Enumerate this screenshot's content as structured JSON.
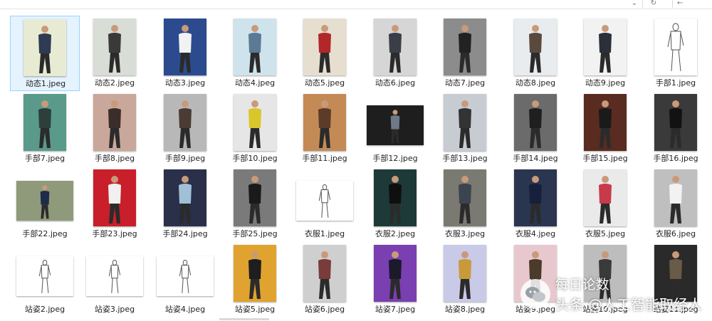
{
  "toolbar": {
    "chevron": "⌄",
    "refresh": "↻",
    "back": "←"
  },
  "colors": {
    "selection_bg": "#e5f3ff",
    "selection_border": "#99d1ff"
  },
  "files": [
    {
      "name": "动态1.jpeg",
      "bg": "#e8ebd3",
      "fig": "#2f3b52",
      "selected": true,
      "kind": "photo"
    },
    {
      "name": "动态2.jpeg",
      "bg": "#d8ddd6",
      "fig": "#3a3a3a",
      "kind": "photo"
    },
    {
      "name": "动态3.jpeg",
      "bg": "#2c4b8f",
      "fig": "#f2f2f2",
      "kind": "photo"
    },
    {
      "name": "动态4.jpeg",
      "bg": "#cfe3ec",
      "fig": "#5b7a95",
      "kind": "photo"
    },
    {
      "name": "动态5.jpeg",
      "bg": "#e6dfd0",
      "fig": "#b3262a",
      "kind": "photo"
    },
    {
      "name": "动态6.jpeg",
      "bg": "#d6d6d6",
      "fig": "#3a3f47",
      "kind": "photo"
    },
    {
      "name": "动态7.jpeg",
      "bg": "#8c8c8c",
      "fig": "#222222",
      "kind": "photo"
    },
    {
      "name": "动态8.jpeg",
      "bg": "#e9ecef",
      "fig": "#5a4a3e",
      "kind": "photo"
    },
    {
      "name": "动态9.jpeg",
      "bg": "#f2f2f2",
      "fig": "#2a2f3a",
      "kind": "photo"
    },
    {
      "name": "手部1.jpeg",
      "bg": "#ffffff",
      "fig": "#555555",
      "kind": "sketch"
    },
    {
      "name": "手部7.jpeg",
      "bg": "#5a9a8a",
      "fig": "#2d3f3b",
      "kind": "photo"
    },
    {
      "name": "手部8.jpeg",
      "bg": "#c9a79b",
      "fig": "#3b2d2a",
      "kind": "photo"
    },
    {
      "name": "手部9.jpeg",
      "bg": "#b8b8b8",
      "fig": "#4a3b33",
      "kind": "photo"
    },
    {
      "name": "手部10.jpeg",
      "bg": "#e6e6e6",
      "fig": "#d9c62a",
      "kind": "photo"
    },
    {
      "name": "手部11.jpeg",
      "bg": "#c48a56",
      "fig": "#5c3c28",
      "kind": "photo"
    },
    {
      "name": "手部12.jpeg",
      "bg": "#1e1e1e",
      "fig": "#6f7a86",
      "kind": "photo"
    },
    {
      "name": "手部13.jpeg",
      "bg": "#c7ccd2",
      "fig": "#333333",
      "kind": "photo"
    },
    {
      "name": "手部14.jpeg",
      "bg": "#6b6b6b",
      "fig": "#1f1f1f",
      "kind": "photo"
    },
    {
      "name": "手部15.jpeg",
      "bg": "#5a2b20",
      "fig": "#1a1a1a",
      "kind": "photo"
    },
    {
      "name": "手部16.jpeg",
      "bg": "#3a3a3a",
      "fig": "#121212",
      "kind": "photo"
    },
    {
      "name": "手部22.jpeg",
      "bg": "#8f9a7a",
      "fig": "#1f2b4a",
      "kind": "photo"
    },
    {
      "name": "手部23.jpeg",
      "bg": "#c81f2a",
      "fig": "#f0f0f0",
      "kind": "photo"
    },
    {
      "name": "手部24.jpeg",
      "bg": "#2a2f4a",
      "fig": "#9fc0d6",
      "kind": "photo"
    },
    {
      "name": "手部25.jpeg",
      "bg": "#7a7a7a",
      "fig": "#1a1a1a",
      "kind": "photo"
    },
    {
      "name": "衣服1.jpeg",
      "bg": "#ffffff",
      "fig": "#555555",
      "kind": "sketch"
    },
    {
      "name": "衣服2.jpeg",
      "bg": "#1d3a38",
      "fig": "#0f0f0f",
      "kind": "photo"
    },
    {
      "name": "衣服3.jpeg",
      "bg": "#7a7a72",
      "fig": "#3c4450",
      "kind": "photo"
    },
    {
      "name": "衣服4.jpeg",
      "bg": "#2a3550",
      "fig": "#16203a",
      "kind": "photo"
    },
    {
      "name": "衣服5.jpeg",
      "bg": "#eaeaea",
      "fig": "#c83a4a",
      "kind": "photo"
    },
    {
      "name": "衣服6.jpeg",
      "bg": "#bfbfbf",
      "fig": "#f2f2f2",
      "kind": "photo"
    },
    {
      "name": "站姿2.jpeg",
      "bg": "#ffffff",
      "fig": "#555555",
      "kind": "sketch"
    },
    {
      "name": "站姿3.jpeg",
      "bg": "#ffffff",
      "fig": "#555555",
      "kind": "sketch"
    },
    {
      "name": "站姿4.jpeg",
      "bg": "#ffffff",
      "fig": "#555555",
      "kind": "sketch"
    },
    {
      "name": "站姿5.jpeg",
      "bg": "#e0a330",
      "fig": "#1e1e1e",
      "kind": "photo"
    },
    {
      "name": "站姿6.jpeg",
      "bg": "#cfcfcf",
      "fig": "#7a3b3b",
      "kind": "photo"
    },
    {
      "name": "站姿7.jpeg",
      "bg": "#7a3fb0",
      "fig": "#1a1a2a",
      "kind": "photo"
    },
    {
      "name": "站姿8.jpeg",
      "bg": "#c9c9e8",
      "fig": "#c89a3a",
      "kind": "photo"
    },
    {
      "name": "站姿9.jpeg",
      "bg": "#e8c8cf",
      "fig": "#4a3b2a",
      "kind": "photo"
    },
    {
      "name": "站姿10.jpeg",
      "bg": "#bdbdbd",
      "fig": "#3a3a3a",
      "kind": "photo"
    },
    {
      "name": "站姿11.jpeg",
      "bg": "#2a2a2a",
      "fig": "#6a5a48",
      "kind": "photo"
    }
  ],
  "watermark": {
    "line1": "每日论数",
    "line2": "头条 @人工智能取经人"
  }
}
